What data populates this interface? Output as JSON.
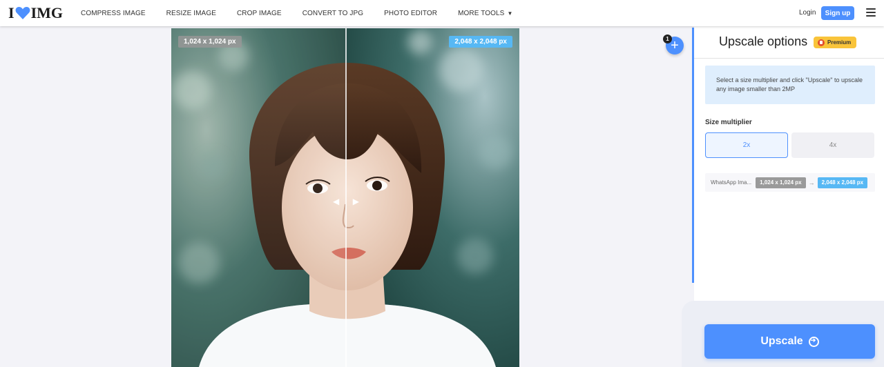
{
  "header": {
    "logo_left": "I",
    "logo_right": "IMG",
    "nav": [
      {
        "label": "COMPRESS IMAGE"
      },
      {
        "label": "RESIZE IMAGE"
      },
      {
        "label": "CROP IMAGE"
      },
      {
        "label": "CONVERT TO JPG"
      },
      {
        "label": "PHOTO EDITOR"
      },
      {
        "label": "MORE TOOLS"
      }
    ],
    "login": "Login",
    "signup": "Sign up"
  },
  "preview": {
    "original_size": "1,024 x 1,024 px",
    "upscaled_size": "2,048 x 2,048 px"
  },
  "add_button": {
    "label": "+",
    "count": "1"
  },
  "sidebar": {
    "title": "Upscale options",
    "badge": "Premium",
    "info": "Select a size multiplier and click \"Upscale\" to upscale any image smaller than 2MP",
    "size_label": "Size multiplier",
    "multipliers": [
      {
        "label": "2x",
        "selected": true
      },
      {
        "label": "4x",
        "selected": false
      }
    ],
    "file": {
      "name": "WhatsApp Ima...",
      "from": "1,024 x 1,024 px",
      "to": "2,048 x 2,048 px"
    },
    "upscale_label": "Upscale"
  },
  "colors": {
    "accent": "#4d90fe",
    "new_size": "#57b8f4",
    "premium": "#f9c43a"
  }
}
